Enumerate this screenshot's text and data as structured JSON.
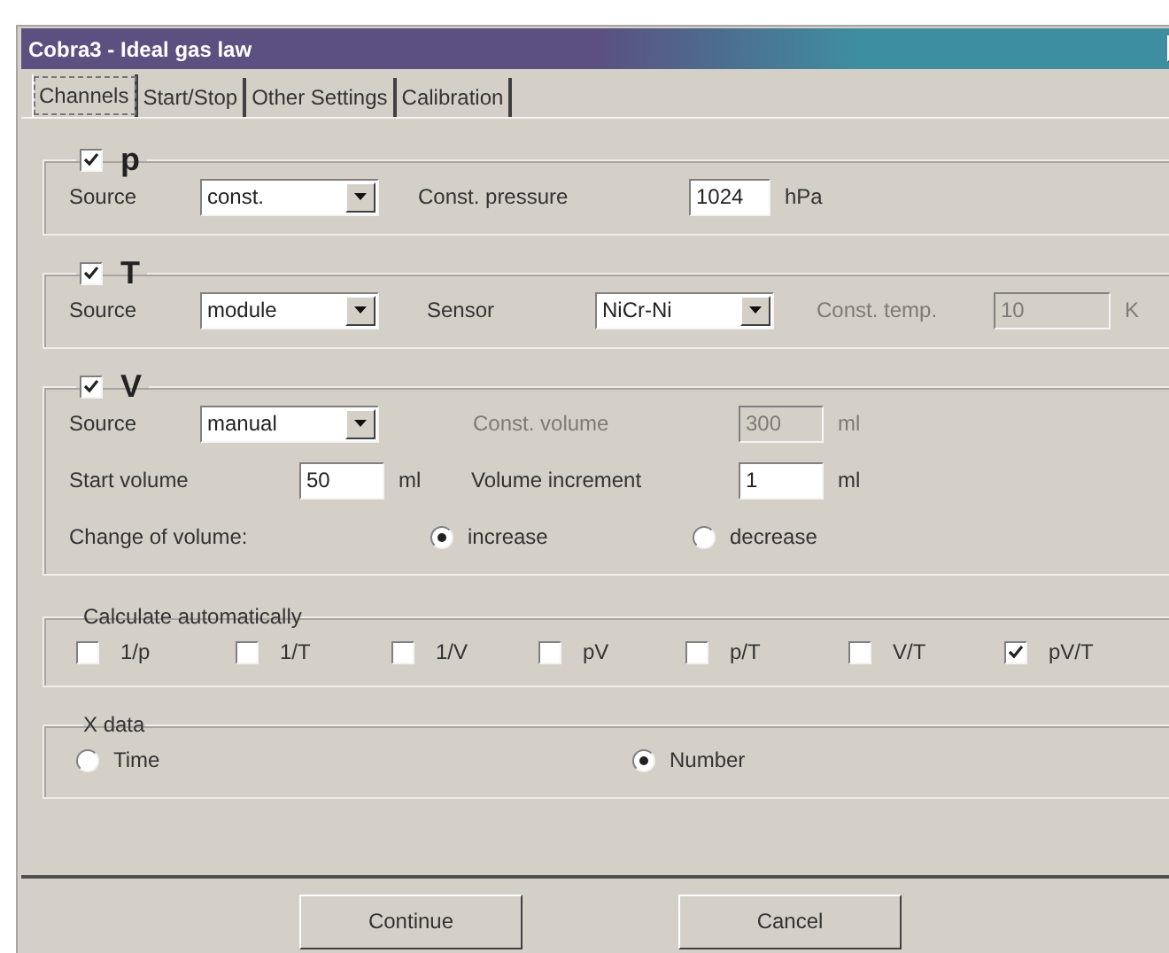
{
  "window": {
    "title": "Cobra3 - Ideal gas law"
  },
  "tabs": [
    {
      "label": "Channels",
      "selected": true
    },
    {
      "label": "Start/Stop",
      "selected": false
    },
    {
      "label": "Other Settings",
      "selected": false
    },
    {
      "label": "Calibration",
      "selected": false
    }
  ],
  "channels": [
    {
      "name": "p",
      "checked": true,
      "rows": [
        [
          {
            "kind": "select",
            "label": "Source",
            "value": "const."
          },
          {
            "kind": "field",
            "label": "Const. pressure",
            "value": "1024",
            "unit": "hPa",
            "disabled": false
          }
        ]
      ]
    },
    {
      "name": "T",
      "checked": true,
      "rows": [
        [
          {
            "kind": "select",
            "label": "Source",
            "value": "module"
          },
          {
            "kind": "select",
            "label": "Sensor",
            "value": "NiCr-Ni"
          },
          {
            "kind": "field",
            "label": "Const. temp.",
            "value": "10",
            "unit": "K",
            "disabled": true
          }
        ]
      ]
    },
    {
      "name": "V",
      "checked": true,
      "rows": [
        [
          {
            "kind": "select",
            "label": "Source",
            "value": "manual"
          },
          {
            "kind": "field",
            "label": "Const. volume",
            "value": "300",
            "unit": "ml",
            "disabled": true
          }
        ],
        [
          {
            "kind": "field",
            "label": "Start volume",
            "value": "50",
            "unit": "ml",
            "disabled": false
          },
          {
            "kind": "field",
            "label": "Volume increment",
            "value": "1",
            "unit": "ml",
            "disabled": false
          }
        ]
      ],
      "change": {
        "label": "Change of volume:",
        "options": [
          {
            "label": "increase",
            "selected": true
          },
          {
            "label": "decrease",
            "selected": false
          }
        ]
      }
    }
  ],
  "calculate": {
    "title": "Calculate automatically",
    "options": [
      {
        "label": "1/p",
        "checked": false
      },
      {
        "label": "1/T",
        "checked": false
      },
      {
        "label": "1/V",
        "checked": false
      },
      {
        "label": "pV",
        "checked": false
      },
      {
        "label": "p/T",
        "checked": false
      },
      {
        "label": "V/T",
        "checked": false
      },
      {
        "label": "pV/T",
        "checked": true
      }
    ]
  },
  "x_data": {
    "title": "X data",
    "options": [
      {
        "label": "Time",
        "selected": false
      },
      {
        "label": "Number",
        "selected": true
      }
    ]
  },
  "buttons": [
    "Continue",
    "Cancel"
  ]
}
